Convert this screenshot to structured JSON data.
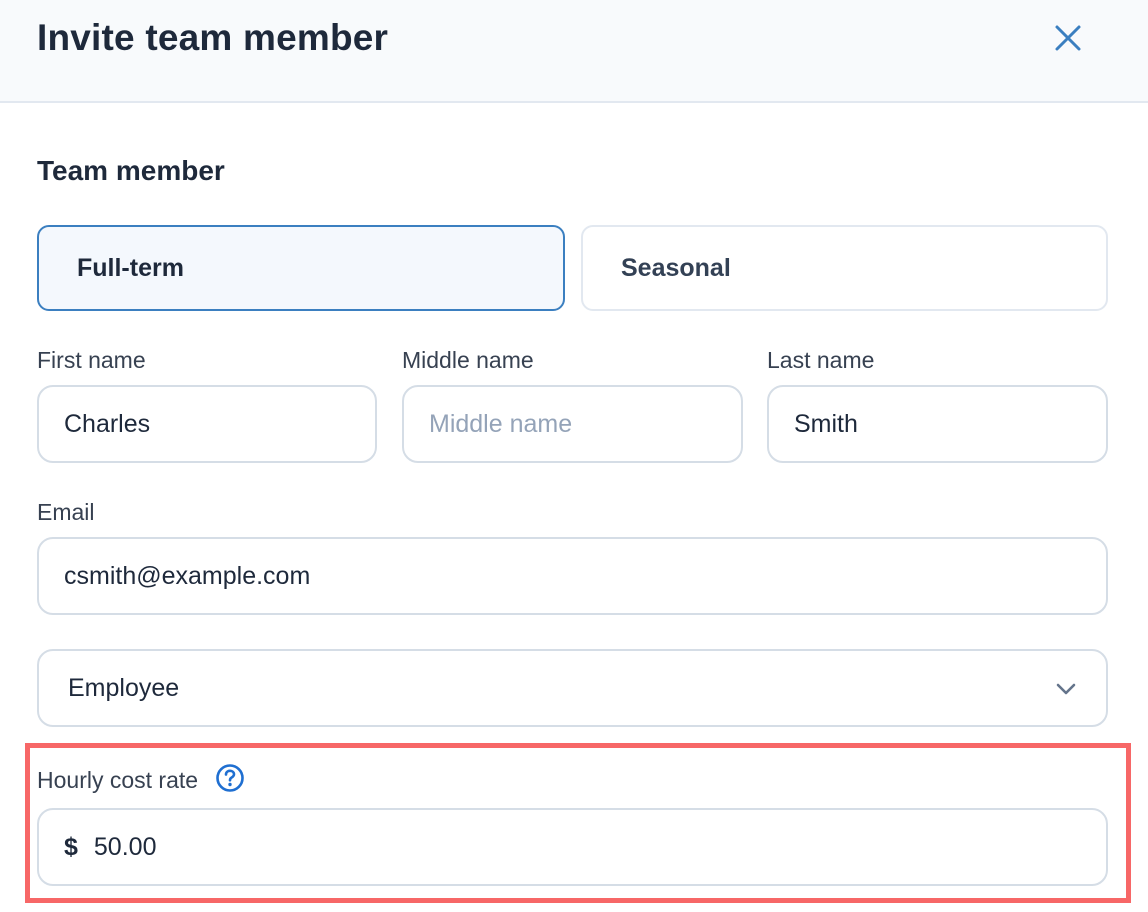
{
  "header": {
    "title": "Invite team member",
    "close_icon": "close-icon"
  },
  "section": {
    "title": "Team member"
  },
  "member_type": {
    "options": [
      "Full-term",
      "Seasonal"
    ],
    "selected": "Full-term"
  },
  "name_fields": {
    "first": {
      "label": "First name",
      "value": "Charles",
      "placeholder": ""
    },
    "middle": {
      "label": "Middle name",
      "value": "",
      "placeholder": "Middle name"
    },
    "last": {
      "label": "Last name",
      "value": "Smith",
      "placeholder": ""
    }
  },
  "email": {
    "label": "Email",
    "value": "csmith@example.com"
  },
  "role_select": {
    "selected": "Employee",
    "icon": "chevron-down-icon"
  },
  "hourly_rate": {
    "label": "Hourly cost rate",
    "help_icon": "question-circle-icon",
    "currency_symbol": "$",
    "value": "50.00"
  },
  "colors": {
    "accent": "#3b7fc0",
    "highlight": "#f76767",
    "border": "#d5dde6",
    "header_bg": "#f8fafc"
  }
}
